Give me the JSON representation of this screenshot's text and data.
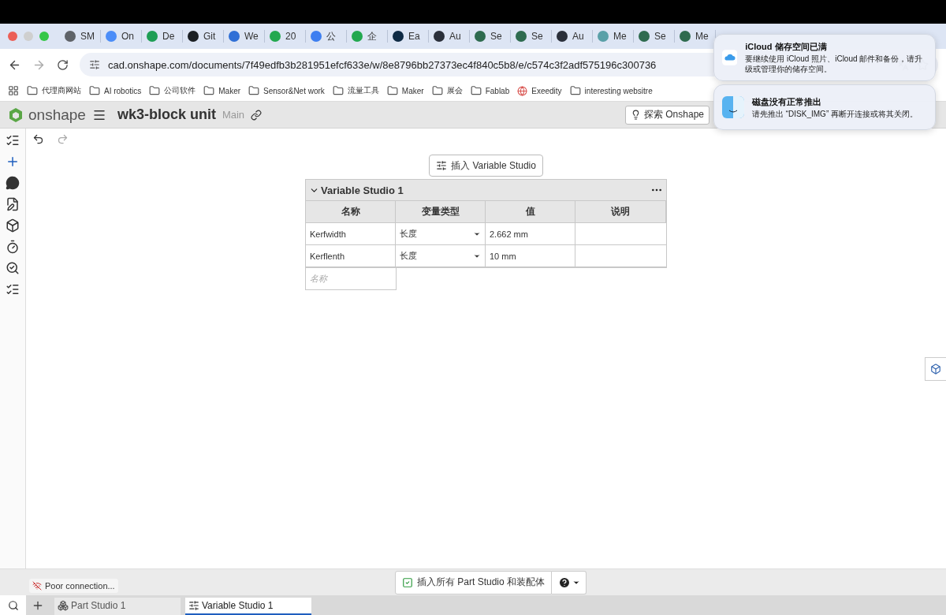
{
  "browser": {
    "tabs": [
      {
        "label": "SM",
        "color": "#5f6368"
      },
      {
        "label": "On",
        "color": "#4b8df8"
      },
      {
        "label": "De",
        "color": "#1e9e55"
      },
      {
        "label": "Git",
        "color": "#1b1f23"
      },
      {
        "label": "We",
        "color": "#2f6fd6"
      },
      {
        "label": "20",
        "color": "#22a84f"
      },
      {
        "label": "公",
        "color": "#3d7ef0"
      },
      {
        "label": "企",
        "color": "#22a84f"
      },
      {
        "label": "Ea",
        "color": "#0e2a44"
      },
      {
        "label": "Au",
        "color": "#2a2f3a"
      },
      {
        "label": "Se",
        "color": "#2e6b4f"
      },
      {
        "label": "Se",
        "color": "#2e6b4f"
      },
      {
        "label": "Au",
        "color": "#2a2f3a"
      },
      {
        "label": "Me",
        "color": "#5aa0a8"
      },
      {
        "label": "Se",
        "color": "#2e6b4f"
      },
      {
        "label": "Me",
        "color": "#2e6b4f"
      }
    ],
    "url": "cad.onshape.com/documents/7f49edfb3b281951efcf633e/w/8e8796bb27373ec4f840c5b8/e/c574c3f2adf575196c300736",
    "bookmarks": [
      {
        "label": "代理商网站",
        "kind": "folder"
      },
      {
        "label": "AI robotics",
        "kind": "folder"
      },
      {
        "label": "公司软件",
        "kind": "folder"
      },
      {
        "label": "Maker",
        "kind": "folder"
      },
      {
        "label": "Sensor&Net work",
        "kind": "folder"
      },
      {
        "label": "流量工具",
        "kind": "folder"
      },
      {
        "label": "Maker",
        "kind": "folder"
      },
      {
        "label": "展会",
        "kind": "folder"
      },
      {
        "label": "Fablab",
        "kind": "folder"
      },
      {
        "label": "Exeedity",
        "kind": "site"
      },
      {
        "label": "interesting websitre",
        "kind": "folder"
      }
    ]
  },
  "app": {
    "logo": "onshape",
    "document": "wk3-block unit",
    "branch": "Main",
    "explore_button": "探索 Onshape"
  },
  "notifications": [
    {
      "kind": "icloud",
      "title": "iCloud 储存空间已满",
      "body": "要继续使用 iCloud 照片、iCloud 邮件和备份，请升级或管理你的储存空间。"
    },
    {
      "kind": "finder",
      "title": "磁盘没有正常推出",
      "body": "请先推出 “DISK_IMG” 再断开连接或将其关闭。"
    }
  ],
  "toolbar": {
    "undo": {
      "disabled": false
    },
    "redo": {
      "disabled": true
    }
  },
  "insert_button": "插入 Variable Studio",
  "variable_studio": {
    "title": "Variable Studio 1",
    "expanded": true,
    "columns": [
      "名称",
      "变量类型",
      "值",
      "说明"
    ],
    "rows": [
      {
        "name": "Kerfwidth",
        "type": "长度",
        "value": "2.662 mm"
      },
      {
        "name": "Kerflenth",
        "type": "长度",
        "value": "10 mm"
      }
    ],
    "new_row_placeholder": "名称"
  },
  "status": {
    "connection": "Poor connection..."
  },
  "insert_all": {
    "label": "插入所有 Part Studio 和装配体",
    "checked": true
  },
  "tabs": [
    {
      "label": "Part Studio 1",
      "kind": "part",
      "selected": false
    },
    {
      "label": "Variable Studio 1",
      "kind": "variable",
      "selected": true
    }
  ]
}
